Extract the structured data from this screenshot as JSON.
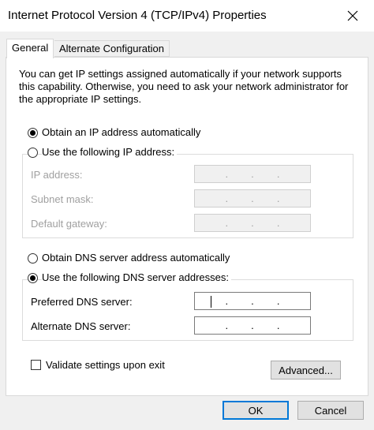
{
  "window": {
    "title": "Internet Protocol Version 4 (TCP/IPv4) Properties"
  },
  "tabs": [
    {
      "label": "General",
      "selected": true
    },
    {
      "label": "Alternate Configuration",
      "selected": false
    }
  ],
  "description": "You can get IP settings assigned automatically if your network supports this capability. Otherwise, you need to ask your network administrator for the appropriate IP settings.",
  "ip_section": {
    "obtain_auto_label": "Obtain an IP address automatically",
    "use_following_label": "Use the following IP address:",
    "selected": "auto",
    "fields": [
      {
        "label": "IP address:",
        "value": ". . ."
      },
      {
        "label": "Subnet mask:",
        "value": ". . ."
      },
      {
        "label": "Default gateway:",
        "value": ". . ."
      }
    ]
  },
  "dns_section": {
    "obtain_auto_label": "Obtain DNS server address automatically",
    "use_following_label": "Use the following DNS server addresses:",
    "selected": "manual",
    "fields": [
      {
        "label": "Preferred DNS server:",
        "value": ". . ."
      },
      {
        "label": "Alternate DNS server:",
        "value": ". . ."
      }
    ]
  },
  "validate_label": "Validate settings upon exit",
  "validate_checked": false,
  "buttons": {
    "advanced": "Advanced...",
    "ok": "OK",
    "cancel": "Cancel"
  },
  "dot": "."
}
